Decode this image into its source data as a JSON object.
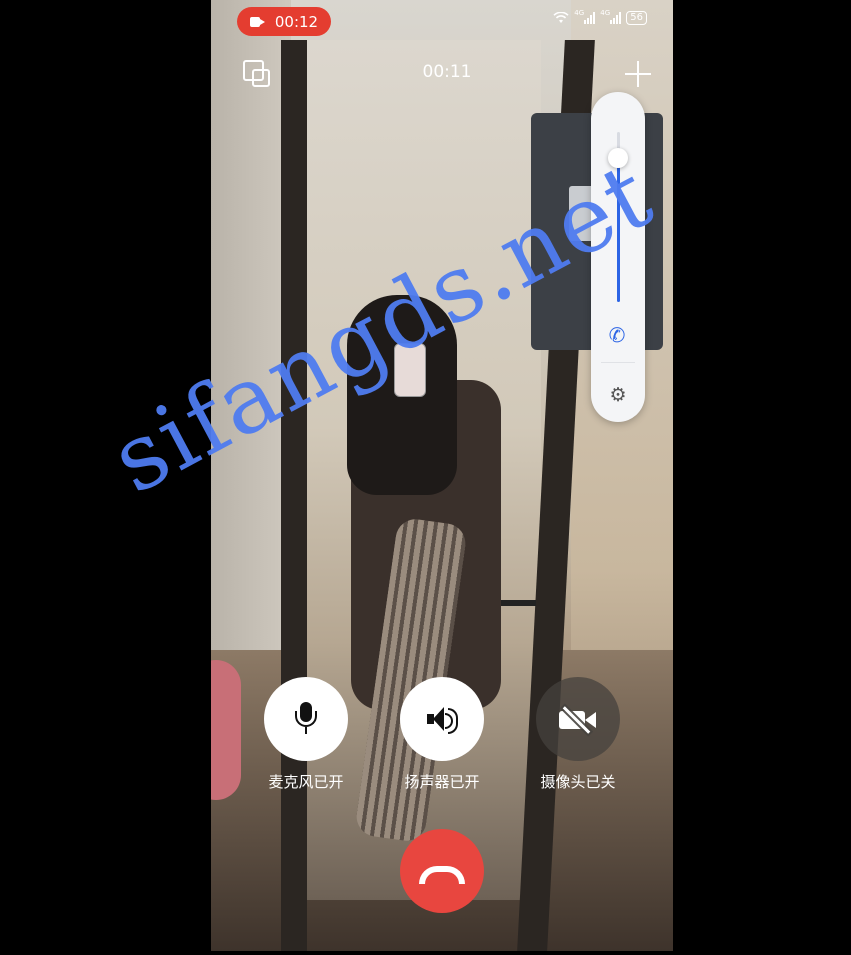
{
  "status_bar": {
    "recording_time": "00:12",
    "network_1": "4G",
    "network_2": "4G",
    "battery": "56"
  },
  "call": {
    "timer": "00:11"
  },
  "icons": {
    "pip": "switch-window-icon",
    "add": "add-participant-icon",
    "volume_phone": "phone-icon",
    "volume_settings": "settings-icon"
  },
  "volume": {
    "level": 0.85
  },
  "controls": {
    "mic_label": "麦克风已开",
    "speaker_label": "扬声器已开",
    "camera_label": "摄像头已关"
  },
  "colors": {
    "recording_pill": "#e43d30",
    "hangup": "#e8463f",
    "volume_accent": "#2c64e5",
    "watermark": "#4f7cf0"
  },
  "watermark": {
    "text": "sifangds.net"
  }
}
